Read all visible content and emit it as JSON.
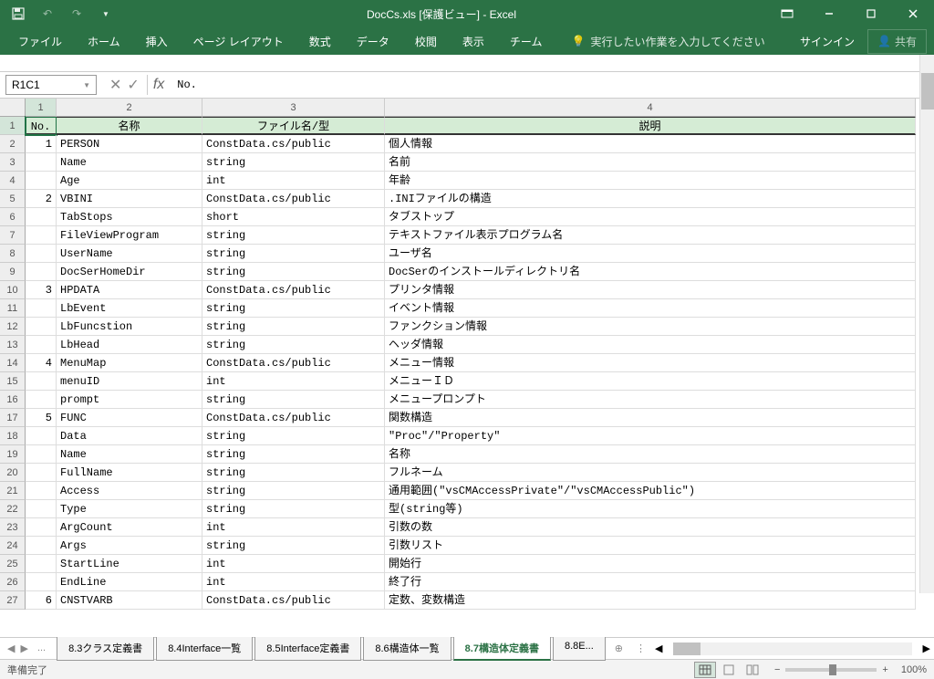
{
  "titlebar": {
    "title": "DocCs.xls  [保護ビュー] - Excel"
  },
  "ribbon": {
    "tabs": [
      "ファイル",
      "ホーム",
      "挿入",
      "ページ レイアウト",
      "数式",
      "データ",
      "校閲",
      "表示",
      "チーム"
    ],
    "tell_me": "実行したい作業を入力してください",
    "signin": "サインイン",
    "share": "共有"
  },
  "namebox": "R1C1",
  "formula": "No.",
  "col_headers": [
    "1",
    "2",
    "3",
    "4"
  ],
  "table_header": {
    "c1": "No.",
    "c2": "名称",
    "c3": "ファイル名/型",
    "c4": "説明"
  },
  "rows": [
    {
      "n": "2",
      "no": "1",
      "name": "PERSON",
      "type": "ConstData.cs/public",
      "desc": "個人情報"
    },
    {
      "n": "3",
      "no": "",
      "name": "Name",
      "type": "string",
      "desc": "名前"
    },
    {
      "n": "4",
      "no": "",
      "name": "Age",
      "type": "int",
      "desc": "年齢"
    },
    {
      "n": "5",
      "no": "2",
      "name": "VBINI",
      "type": "ConstData.cs/public",
      "desc": ".INIファイルの構造"
    },
    {
      "n": "6",
      "no": "",
      "name": "TabStops",
      "type": "short",
      "desc": "タブストップ"
    },
    {
      "n": "7",
      "no": "",
      "name": "FileViewProgram",
      "type": "string",
      "desc": "テキストファイル表示プログラム名"
    },
    {
      "n": "8",
      "no": "",
      "name": "UserName",
      "type": "string",
      "desc": "ユーザ名"
    },
    {
      "n": "9",
      "no": "",
      "name": "DocSerHomeDir",
      "type": "string",
      "desc": "DocSerのインストールディレクトリ名"
    },
    {
      "n": "10",
      "no": "3",
      "name": "HPDATA",
      "type": "ConstData.cs/public",
      "desc": "プリンタ情報"
    },
    {
      "n": "11",
      "no": "",
      "name": "LbEvent",
      "type": "string",
      "desc": "イベント情報"
    },
    {
      "n": "12",
      "no": "",
      "name": "LbFuncstion",
      "type": "string",
      "desc": "ファンクション情報"
    },
    {
      "n": "13",
      "no": "",
      "name": "LbHead",
      "type": "string",
      "desc": "ヘッダ情報"
    },
    {
      "n": "14",
      "no": "4",
      "name": "MenuMap",
      "type": "ConstData.cs/public",
      "desc": "メニュー情報"
    },
    {
      "n": "15",
      "no": "",
      "name": "menuID",
      "type": "int",
      "desc": "メニューＩＤ"
    },
    {
      "n": "16",
      "no": "",
      "name": "prompt",
      "type": "string",
      "desc": "メニュープロンプト"
    },
    {
      "n": "17",
      "no": "5",
      "name": "FUNC",
      "type": "ConstData.cs/public",
      "desc": "関数構造"
    },
    {
      "n": "18",
      "no": "",
      "name": "Data",
      "type": "string",
      "desc": "\"Proc\"/\"Property\""
    },
    {
      "n": "19",
      "no": "",
      "name": "Name",
      "type": "string",
      "desc": "名称"
    },
    {
      "n": "20",
      "no": "",
      "name": "FullName",
      "type": "string",
      "desc": "フルネーム"
    },
    {
      "n": "21",
      "no": "",
      "name": "Access",
      "type": "string",
      "desc": "通用範囲(\"vsCMAccessPrivate\"/\"vsCMAccessPublic\")"
    },
    {
      "n": "22",
      "no": "",
      "name": "Type",
      "type": "string",
      "desc": "型(string等)"
    },
    {
      "n": "23",
      "no": "",
      "name": "ArgCount",
      "type": "int",
      "desc": "引数の数"
    },
    {
      "n": "24",
      "no": "",
      "name": "Args",
      "type": "string",
      "desc": "引数リスト"
    },
    {
      "n": "25",
      "no": "",
      "name": "StartLine",
      "type": "int",
      "desc": "開始行"
    },
    {
      "n": "26",
      "no": "",
      "name": "EndLine",
      "type": "int",
      "desc": "終了行"
    },
    {
      "n": "27",
      "no": "6",
      "name": "CNSTVARB",
      "type": "ConstData.cs/public",
      "desc": "定数、変数構造"
    }
  ],
  "sheet_tabs": {
    "overflow": "...",
    "tabs": [
      "8.3クラス定義書",
      "8.4Interface一覧",
      "8.5Interface定義書",
      "8.6構造体一覧",
      "8.7構造体定義書",
      "8.8E..."
    ],
    "active": 4
  },
  "statusbar": {
    "ready": "準備完了",
    "zoom": "100%"
  }
}
